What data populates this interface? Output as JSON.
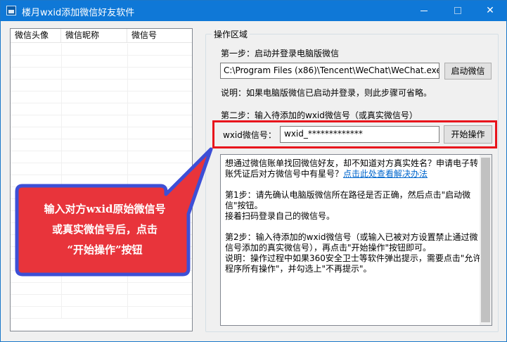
{
  "window": {
    "title": "楼月wxid添加微信好友软件",
    "minimize": "—",
    "close": "✕",
    "accent": "#0f78d7"
  },
  "list": {
    "columns": [
      "微信头像",
      "微信昵称",
      "微信号"
    ],
    "rows": []
  },
  "operations": {
    "group_title": "操作区域",
    "step1_label": "第一步：启动并登录电脑版微信",
    "wechat_path": "C:\\Program Files (x86)\\Tencent\\WeChat\\WeChat.exe",
    "launch_button": "启动微信",
    "note": "说明：如果电脑版微信已启动并登录，则此步骤可省略。",
    "step2_label": "第二步：输入待添加的wxid微信号（或真实微信号）",
    "wxid_label": "wxid微信号：",
    "wxid_value": "wxid_*************",
    "start_button": "开始操作",
    "highlight_color": "#e8141c"
  },
  "info": {
    "p1_text": "想通过微信账单找回微信好友，却不知道对方真实姓名？申请电子转账凭证后对方微信号中有星号？",
    "p1_link": "点击此处查看解决办法",
    "p2": "第1步：请先确认电脑版微信所在路径是否正确，然后点击\"启动微信\"按钮。",
    "p2b": "接着扫码登录自己的微信号。",
    "p3": "第2步：输入待添加的wxid微信号（或输入已被对方设置禁止通过微信号添加的真实微信号），再点击\"开始操作\"按钮即可。",
    "p3b": "说明：操作过程中如果360安全卫士等软件弹出提示，需要点击\"允许程序所有操作\"，并勾选上\"不再提示\"。"
  },
  "callout": {
    "line1": "输入对方wxid原始微信号",
    "line2": "或真实微信号后，点击",
    "line3": "“开始操作”按钮",
    "fill": "#e8343b",
    "border": "#3d4fd6"
  }
}
